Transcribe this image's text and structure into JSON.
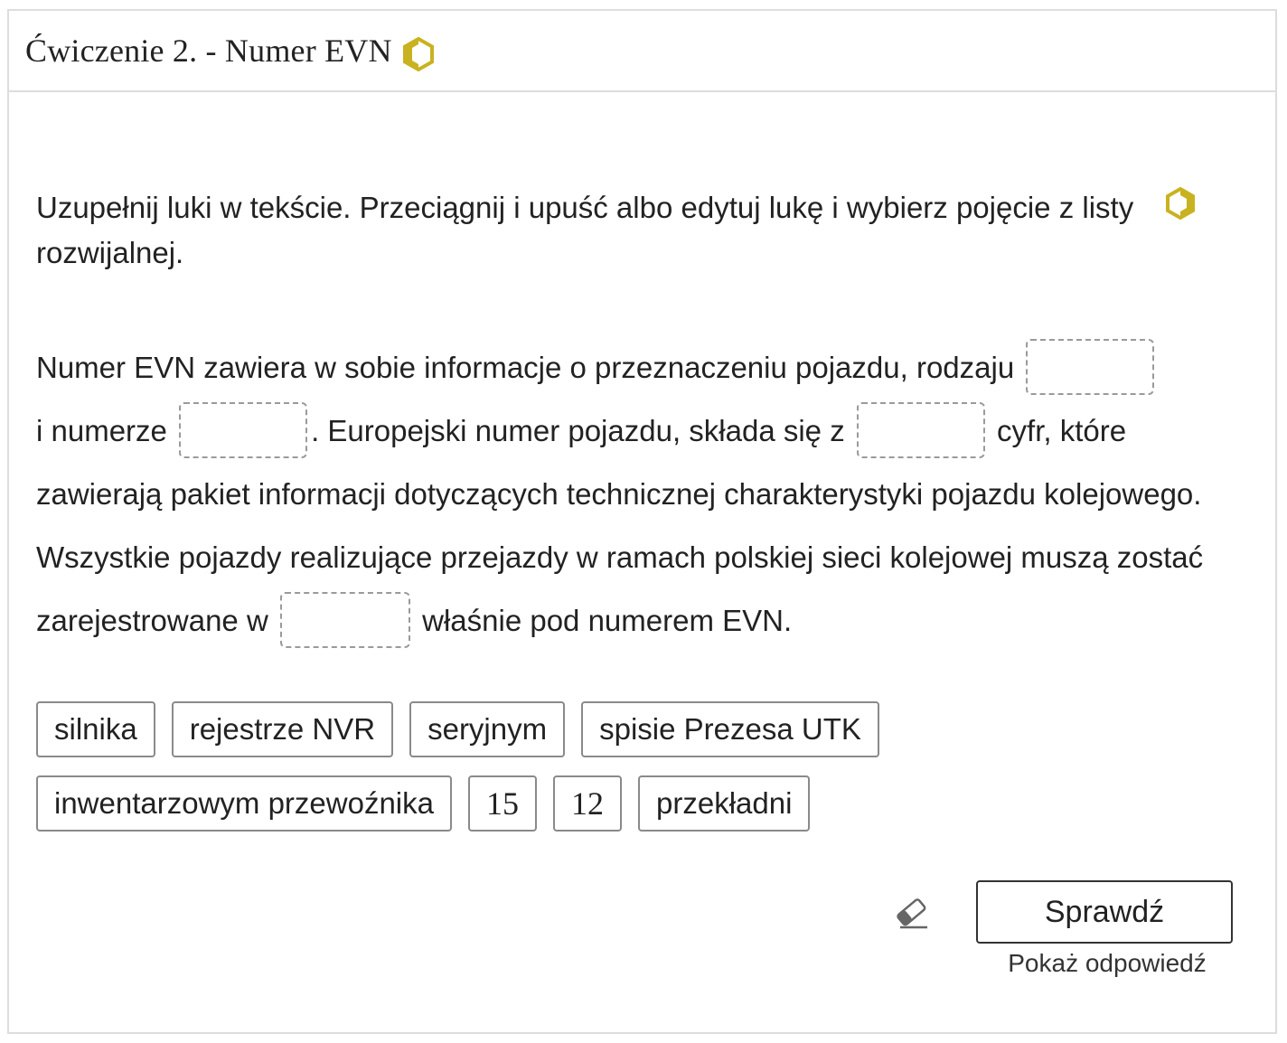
{
  "exercise": {
    "title": "Ćwiczenie 2. - Numer EVN",
    "difficulty_icon": "hexagon-half-icon",
    "instruction": "Uzupełnij luki w tekście. Przeciągnij i upuść albo edytuj lukę i wybierz pojęcie z listy rozwijalnej.",
    "text_parts": [
      "Numer EVN zawiera w sobie informacje o przeznaczeniu pojazdu, rodzaju",
      "i numerze",
      ". Europejski numer pojazdu, składa się z",
      "cyfr, które zawierają pakiet informacji dotyczących technicznej charakterystyki pojazdu kolejowego. Wszystkie pojazdy realizujące przejazdy w ramach polskiej sieci kolejowej muszą zostać zarejestrowane w",
      "właśnie pod numerem EVN."
    ],
    "options_row1": [
      "silnika",
      "rejestrze NVR",
      "seryjnym",
      "spisie Prezesa UTK"
    ],
    "options_row2": [
      "inwentarzowym przewoźnika",
      "15",
      "12",
      "przekładni"
    ],
    "check_label": "Sprawdź",
    "show_answer_label": "Pokaż odpowiedź",
    "eraser_icon": "eraser-icon",
    "accent_color": "#c9b21f"
  }
}
